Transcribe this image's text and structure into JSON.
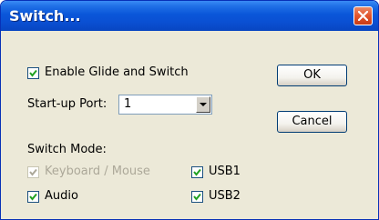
{
  "window": {
    "title": "Switch..."
  },
  "options": {
    "enable_glide": {
      "label": "Enable Glide and Switch",
      "checked": true
    },
    "startup_port": {
      "label": "Start-up Port:",
      "value": "1"
    }
  },
  "buttons": {
    "ok_label": "OK",
    "cancel_label": "Cancel"
  },
  "switch_mode": {
    "heading": "Switch Mode:",
    "keyboard_mouse": {
      "label": "Keyboard / Mouse",
      "checked": true,
      "disabled": true
    },
    "audio": {
      "label": "Audio",
      "checked": true
    },
    "usb1": {
      "label": "USB1",
      "checked": true
    },
    "usb2": {
      "label": "USB2",
      "checked": true
    }
  },
  "colors": {
    "titlebar": "#0a50d3",
    "dialog_bg": "#ece9d8",
    "close_button": "#e2542c",
    "disabled_text": "#aca899"
  }
}
